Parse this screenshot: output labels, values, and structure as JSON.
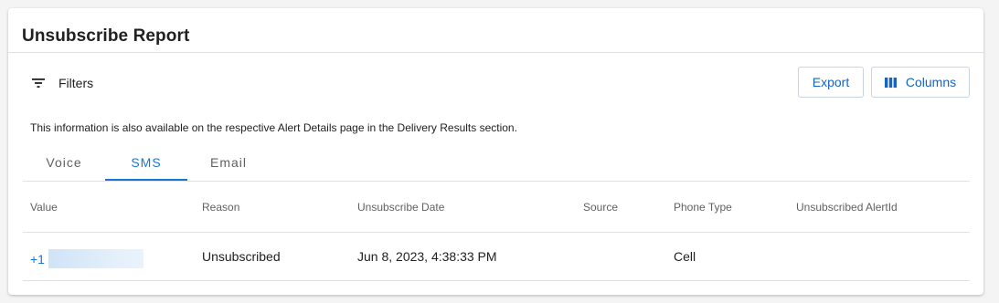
{
  "card": {
    "title": "Unsubscribe Report"
  },
  "toolbar": {
    "filters_label": "Filters",
    "filters_icon": "filter-list-icon",
    "export_label": "Export",
    "columns_label": "Columns",
    "columns_icon": "view-columns-icon"
  },
  "info_text": "This information is also available on the respective Alert Details page in the Delivery Results section.",
  "tabs": [
    {
      "label": "Voice",
      "active": false
    },
    {
      "label": "SMS",
      "active": true
    },
    {
      "label": "Email",
      "active": false
    }
  ],
  "table": {
    "columns": [
      "Value",
      "Reason",
      "Unsubscribe Date",
      "Source",
      "Phone Type",
      "Unsubscribed AlertId"
    ],
    "rows": [
      {
        "value": "+1",
        "reason": "Unsubscribed",
        "unsubscribe_date": "Jun 8, 2023, 4:38:33 PM",
        "source": "",
        "phone_type": "Cell",
        "unsubscribed_alert_id": ""
      }
    ]
  },
  "colors": {
    "accent": "#1976d2",
    "divider": "#e0e0e0",
    "background": "#f4f4f4"
  }
}
